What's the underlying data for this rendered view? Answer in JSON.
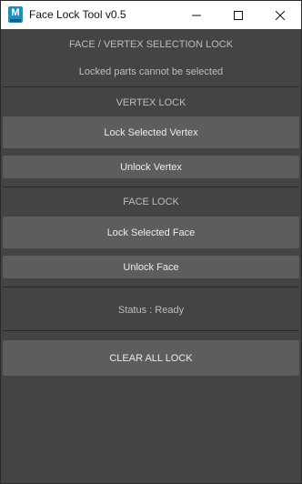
{
  "window": {
    "title": "Face Lock Tool v0.5",
    "app_icon_letter": "M"
  },
  "header": {
    "heading": "FACE / VERTEX SELECTION LOCK",
    "note": "Locked parts cannot be selected"
  },
  "vertex_section": {
    "heading": "VERTEX LOCK",
    "lock_label": "Lock Selected Vertex",
    "unlock_label": "Unlock Vertex"
  },
  "face_section": {
    "heading": "FACE LOCK",
    "lock_label": "Lock Selected Face",
    "unlock_label": "Unlock Face"
  },
  "status": {
    "text": "Status : Ready"
  },
  "actions": {
    "clear_all_label": "CLEAR ALL LOCK"
  },
  "colors": {
    "panel_bg": "#444444",
    "button_bg": "#5d5d5d",
    "label_text": "#bdbdbd",
    "button_text": "#ececec"
  }
}
